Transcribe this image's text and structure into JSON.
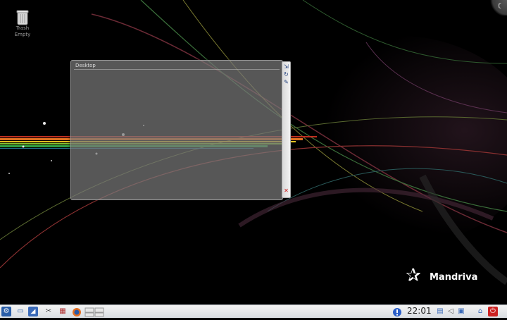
{
  "desktop": {
    "trash": {
      "label_line1": "Trash",
      "label_line2": "Empty",
      "icon": "trash-icon"
    },
    "cashew_icon": "moon-icon",
    "folder_view": {
      "title": "Desktop"
    },
    "applet_handle": {
      "buttons": [
        "resize-icon",
        "rotate-icon",
        "settings-icon",
        "close-icon"
      ]
    },
    "logo": {
      "text": "Mandriva",
      "icon": "mandriva-star-icon"
    }
  },
  "taskbar": {
    "launchers": [
      "kde-menu-icon",
      "show-desktop-icon",
      "dolphin-icon",
      "settings-icon",
      "network-icon",
      "firefox-icon",
      "pager-icon"
    ],
    "tray": [
      "info-icon",
      "clipboard-icon",
      "volume-icon",
      "network-tray-icon",
      "lock-icon",
      "power-icon"
    ],
    "clock": "22:01"
  },
  "colors": {
    "plasmoid_bg": "#787878",
    "taskbar_bg": "#e4e7ea",
    "shutdown_red": "#cc2222"
  }
}
